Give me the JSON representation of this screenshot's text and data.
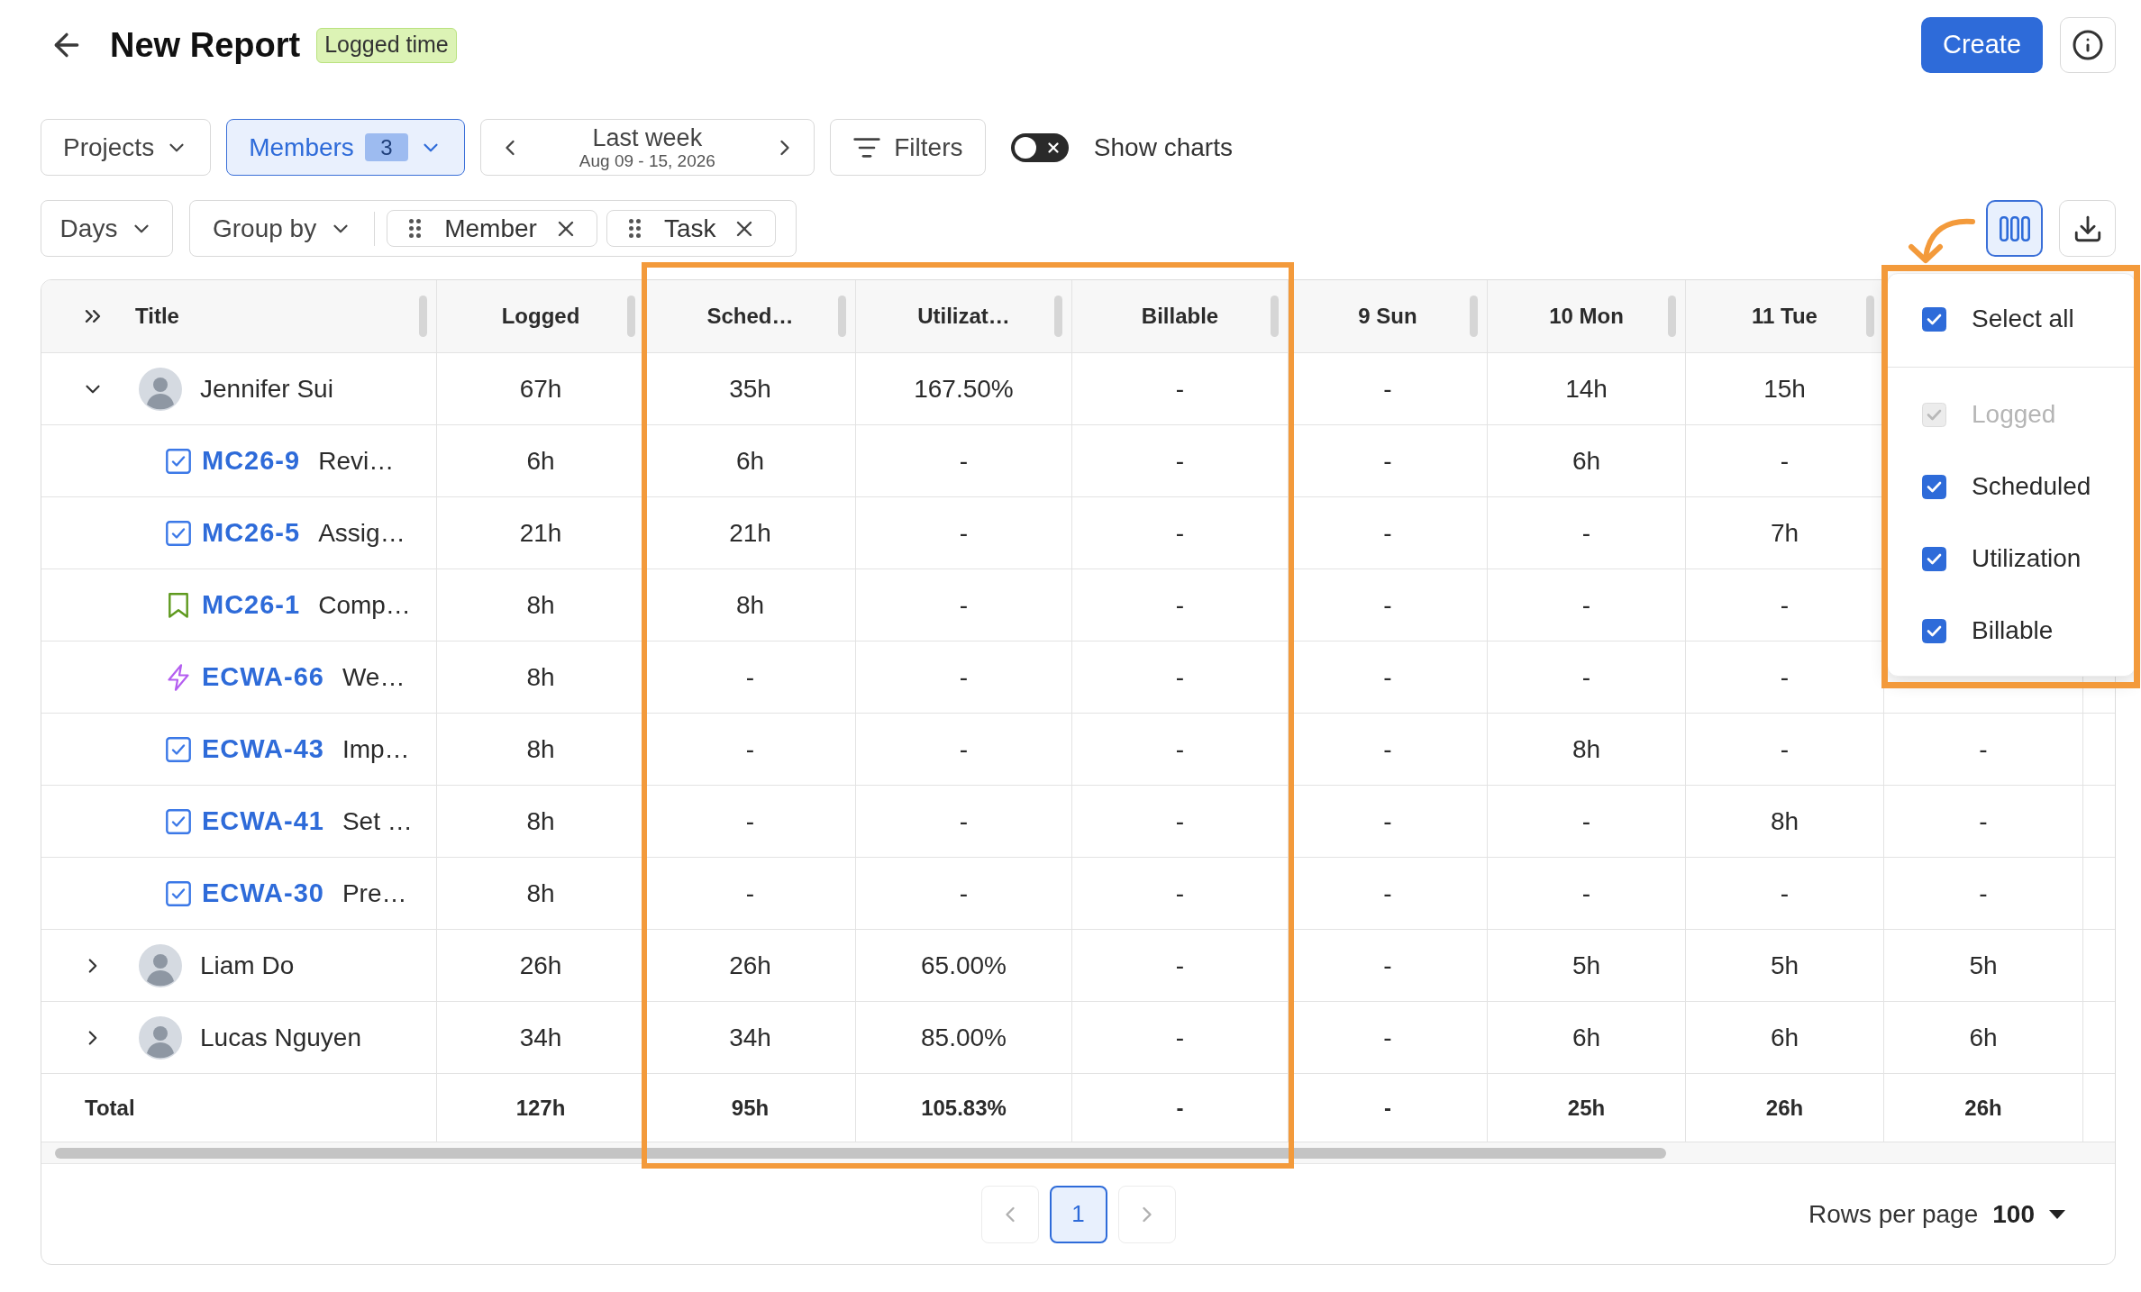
{
  "header": {
    "title": "New Report",
    "badge": "Logged time",
    "create_button": "Create"
  },
  "filters": {
    "items": [
      {
        "kind": "dropdown",
        "label": "Projects",
        "active": false
      },
      {
        "kind": "dropdown",
        "label": "Members",
        "count": "3",
        "active": true
      },
      {
        "kind": "date_range",
        "label": "Last week",
        "range": "Aug 09 - 15, 2026"
      },
      {
        "kind": "button",
        "label": "Filters"
      }
    ],
    "charts_toggle": {
      "label": "Show charts",
      "on": false
    }
  },
  "view": {
    "period": "Days",
    "group_by": {
      "label": "Group by",
      "chips": [
        "Member",
        "Task"
      ]
    },
    "columns_button": {
      "active": true
    }
  },
  "table": {
    "title_column": "Title",
    "columns": [
      "Logged",
      "Sched…",
      "Utilizat…",
      "Billable",
      "9 Sun",
      "10 Mon",
      "11 Tue"
    ],
    "rows": [
      {
        "name": "Jennifer Sui",
        "expanded": true,
        "cells": [
          "67h",
          "35h",
          "167.50%",
          "-",
          "-",
          "14h",
          "15h"
        ],
        "children": [
          {
            "kind": "task",
            "key": "MC26-9",
            "title": "Revi…",
            "cells": [
              "6h",
              "6h",
              "-",
              "-",
              "-",
              "6h",
              "-"
            ]
          },
          {
            "kind": "task",
            "key": "MC26-5",
            "title": "Assig…",
            "cells": [
              "21h",
              "21h",
              "-",
              "-",
              "-",
              "-",
              "7h"
            ]
          },
          {
            "kind": "story",
            "key": "MC26-1",
            "title": "Comp…",
            "cells": [
              "8h",
              "8h",
              "-",
              "-",
              "-",
              "-",
              "-"
            ]
          },
          {
            "kind": "epic",
            "key": "ECWA-66",
            "title": "We…",
            "cells": [
              "8h",
              "-",
              "-",
              "-",
              "-",
              "-",
              "-"
            ]
          },
          {
            "kind": "task",
            "key": "ECWA-43",
            "title": "Imp…",
            "cells": [
              "8h",
              "-",
              "-",
              "-",
              "-",
              "8h",
              "-"
            ],
            "column_9": "-"
          },
          {
            "kind": "task",
            "key": "ECWA-41",
            "title": "Set …",
            "cells": [
              "8h",
              "-",
              "-",
              "-",
              "-",
              "-",
              "8h"
            ],
            "column_9": "-"
          },
          {
            "kind": "task",
            "key": "ECWA-30",
            "title": "Pre…",
            "cells": [
              "8h",
              "-",
              "-",
              "-",
              "-",
              "-",
              "-"
            ],
            "column_9": "-"
          }
        ]
      },
      {
        "name": "Liam Do",
        "expanded": false,
        "cells": [
          "26h",
          "26h",
          "65.00%",
          "-",
          "-",
          "5h",
          "5h"
        ],
        "column_9": "5h"
      },
      {
        "name": "Lucas Nguyen",
        "expanded": false,
        "cells": [
          "34h",
          "34h",
          "85.00%",
          "-",
          "-",
          "6h",
          "6h"
        ],
        "column_9": "6h"
      }
    ],
    "total": {
      "label": "Total",
      "cells": [
        "127h",
        "95h",
        "105.83%",
        "-",
        "-",
        "25h",
        "26h"
      ],
      "column_9": "26h"
    }
  },
  "column_menu": {
    "items": [
      {
        "kind": "select_all",
        "label": "Select all",
        "checked": true,
        "disabled": false
      },
      {
        "kind": "column",
        "label": "Logged",
        "checked": true,
        "disabled": true
      },
      {
        "kind": "column",
        "label": "Scheduled",
        "checked": true,
        "disabled": false
      },
      {
        "kind": "column",
        "label": "Utilization",
        "checked": true,
        "disabled": false
      },
      {
        "kind": "column",
        "label": "Billable",
        "checked": true,
        "disabled": false
      }
    ]
  },
  "pagination": {
    "previous_disabled": true,
    "pages": [
      {
        "label": "1",
        "selected": true
      }
    ],
    "next_disabled": true,
    "rows_per_page": {
      "label": "Rows per page",
      "value": "100"
    }
  }
}
